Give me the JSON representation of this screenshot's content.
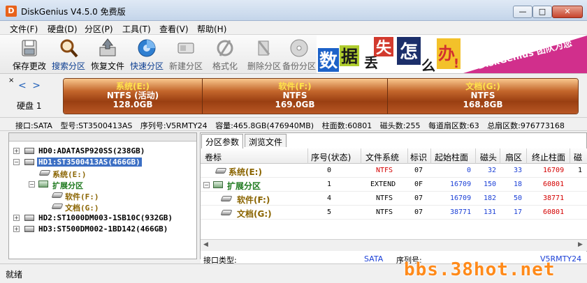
{
  "window": {
    "title": "DiskGenius V4.5.0 免费版",
    "icon_letter": "D",
    "min": "—",
    "max": "□",
    "close": "✕"
  },
  "menu": [
    "文件(F)",
    "硬盘(D)",
    "分区(P)",
    "工具(T)",
    "查看(V)",
    "帮助(H)"
  ],
  "toolbar": [
    {
      "label": "保存更改",
      "icon": "save-icon"
    },
    {
      "label": "搜索分区",
      "icon": "magnifier-icon"
    },
    {
      "label": "恢复文件",
      "icon": "recover-icon"
    },
    {
      "label": "快速分区",
      "icon": "quick-partition-icon"
    },
    {
      "label": "新建分区",
      "icon": "new-partition-icon"
    },
    {
      "label": "格式化",
      "icon": "format-icon"
    },
    {
      "label": "删除分区",
      "icon": "delete-icon"
    },
    {
      "label": "备份分区",
      "icon": "backup-icon"
    }
  ],
  "banner": {
    "chars": [
      "数",
      "据",
      "丢",
      "失",
      "怎",
      "么",
      "办",
      "!"
    ],
    "slogan": "DiskGenius 团队为您"
  },
  "disk_panel": {
    "label": "硬盘 1",
    "nav_prev": "<",
    "nav_next": ">",
    "close": "×"
  },
  "partitions_bar": [
    {
      "name": "系统(E:)",
      "fs": "NTFS (活动)",
      "size": "128.0GB",
      "share": 0.274
    },
    {
      "name": "软件(F:)",
      "fs": "NTFS",
      "size": "169.0GB",
      "share": 0.362
    },
    {
      "name": "文档(G:)",
      "fs": "NTFS",
      "size": "168.8GB",
      "share": 0.364
    }
  ],
  "info_bar": [
    "接口:SATA",
    "型号:ST3500413AS",
    "序列号:V5RMTY24",
    "容量:465.8GB(476940MB)",
    "柱面数:60801",
    "磁头数:255",
    "每道扇区数:63",
    "总扇区数:976773168"
  ],
  "tree": {
    "nodes": [
      {
        "label": "HD0:ADATASP920SS(238GB)",
        "type": "disk",
        "expander": "+"
      },
      {
        "label": "HD1:ST3500413AS(466GB)",
        "type": "disk",
        "expander": "−",
        "selected": true
      },
      {
        "label": "系统(E:)",
        "type": "part"
      },
      {
        "label": "扩展分区",
        "type": "ext",
        "expander": "−"
      },
      {
        "label": "软件(F:)",
        "type": "part"
      },
      {
        "label": "文档(G:)",
        "type": "part"
      },
      {
        "label": "HD2:ST1000DM003-1SB10C(932GB)",
        "type": "disk",
        "expander": "+"
      },
      {
        "label": "HD3:ST500DM002-1BD142(466GB)",
        "type": "disk",
        "expander": "+"
      }
    ]
  },
  "tabs": [
    "分区参数",
    "浏览文件"
  ],
  "grid": {
    "headers": [
      "卷标",
      "序号(状态)",
      "文件系统",
      "标识",
      "起始柱面",
      "磁头",
      "扇区",
      "终止柱面",
      "磁"
    ],
    "rows": [
      {
        "name": "系统(E:)",
        "idx": "0",
        "fs": "NTFS",
        "id": "07",
        "start_cyl": "0",
        "head": "32",
        "sector": "33",
        "end_cyl": "16709",
        "extra": "1",
        "kind": "part"
      },
      {
        "name": "扩展分区",
        "idx": "1",
        "fs": "EXTEND",
        "id": "0F",
        "start_cyl": "16709",
        "head": "150",
        "sector": "18",
        "end_cyl": "60801",
        "extra": "",
        "kind": "ext"
      },
      {
        "name": "软件(F:)",
        "idx": "4",
        "fs": "NTFS",
        "id": "07",
        "start_cyl": "16709",
        "head": "182",
        "sector": "50",
        "end_cyl": "38771",
        "extra": "",
        "kind": "part"
      },
      {
        "name": "文档(G:)",
        "idx": "5",
        "fs": "NTFS",
        "id": "07",
        "start_cyl": "38771",
        "head": "131",
        "sector": "17",
        "end_cyl": "60801",
        "extra": "",
        "kind": "part"
      }
    ]
  },
  "bottom_info": {
    "iface_label": "接口类型:",
    "iface_value": "SATA",
    "serial_label": "序列号:",
    "serial_value": "V5RMTY24"
  },
  "status": "就绪",
  "watermark": "bbs.38hot.net",
  "colors": {
    "accent": "#3c6fc4",
    "partition": "#b85724",
    "label_gold": "#ffe24a",
    "ext_green": "#1f7a1f"
  }
}
